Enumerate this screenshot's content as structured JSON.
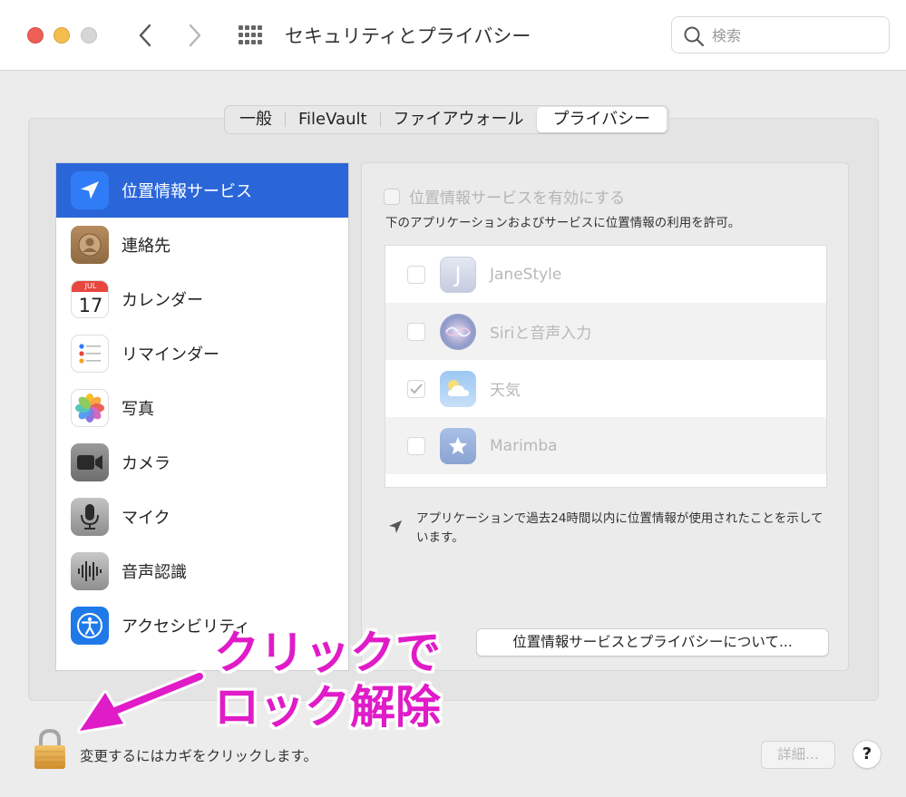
{
  "window": {
    "title": "セキュリティとプライバシー",
    "search_placeholder": "検索"
  },
  "tabs": [
    {
      "label": "一般",
      "active": false
    },
    {
      "label": "FileVault",
      "active": false
    },
    {
      "label": "ファイアウォール",
      "active": false
    },
    {
      "label": "プライバシー",
      "active": true
    }
  ],
  "sidebar": {
    "items": [
      {
        "label": "位置情報サービス",
        "icon": "location-arrow-icon",
        "selected": true
      },
      {
        "label": "連絡先",
        "icon": "contacts-icon",
        "selected": false
      },
      {
        "label": "カレンダー",
        "icon": "calendar-icon",
        "selected": false,
        "icon_month": "JUL",
        "icon_day": "17"
      },
      {
        "label": "リマインダー",
        "icon": "reminders-icon",
        "selected": false
      },
      {
        "label": "写真",
        "icon": "photos-icon",
        "selected": false
      },
      {
        "label": "カメラ",
        "icon": "camera-icon",
        "selected": false
      },
      {
        "label": "マイク",
        "icon": "microphone-icon",
        "selected": false
      },
      {
        "label": "音声認識",
        "icon": "speech-recognition-icon",
        "selected": false
      },
      {
        "label": "アクセシビリティ",
        "icon": "accessibility-icon",
        "selected": false
      }
    ]
  },
  "location": {
    "enable_label": "位置情報サービスを有効にする",
    "enabled": false,
    "allow_desc": "下のアプリケーションおよびサービスに位置情報の利用を許可。",
    "apps": [
      {
        "name": "JaneStyle",
        "checked": false,
        "icon": "janestyle-icon",
        "icon_letter": "J"
      },
      {
        "name": "Siriと音声入力",
        "checked": false,
        "icon": "siri-icon"
      },
      {
        "name": "天気",
        "checked": true,
        "icon": "weather-icon"
      },
      {
        "name": "Marimba",
        "checked": false,
        "icon": "marimba-icon"
      }
    ],
    "recent_note": "アプリケーションで過去24時間以内に位置情報が使用されたことを示しています。",
    "about_button": "位置情報サービスとプライバシーについて..."
  },
  "annotation": {
    "line1": "クリックで",
    "line2": "ロック解除",
    "color": "#e01bc8"
  },
  "footer": {
    "lock_text": "変更するにはカギをクリックします。",
    "detail_button": "詳細...",
    "help_button": "?"
  },
  "colors": {
    "selection": "#2b66d9",
    "close": "#ed5f57",
    "minimize": "#f4be4f",
    "zoom": "#d6d6d6"
  }
}
